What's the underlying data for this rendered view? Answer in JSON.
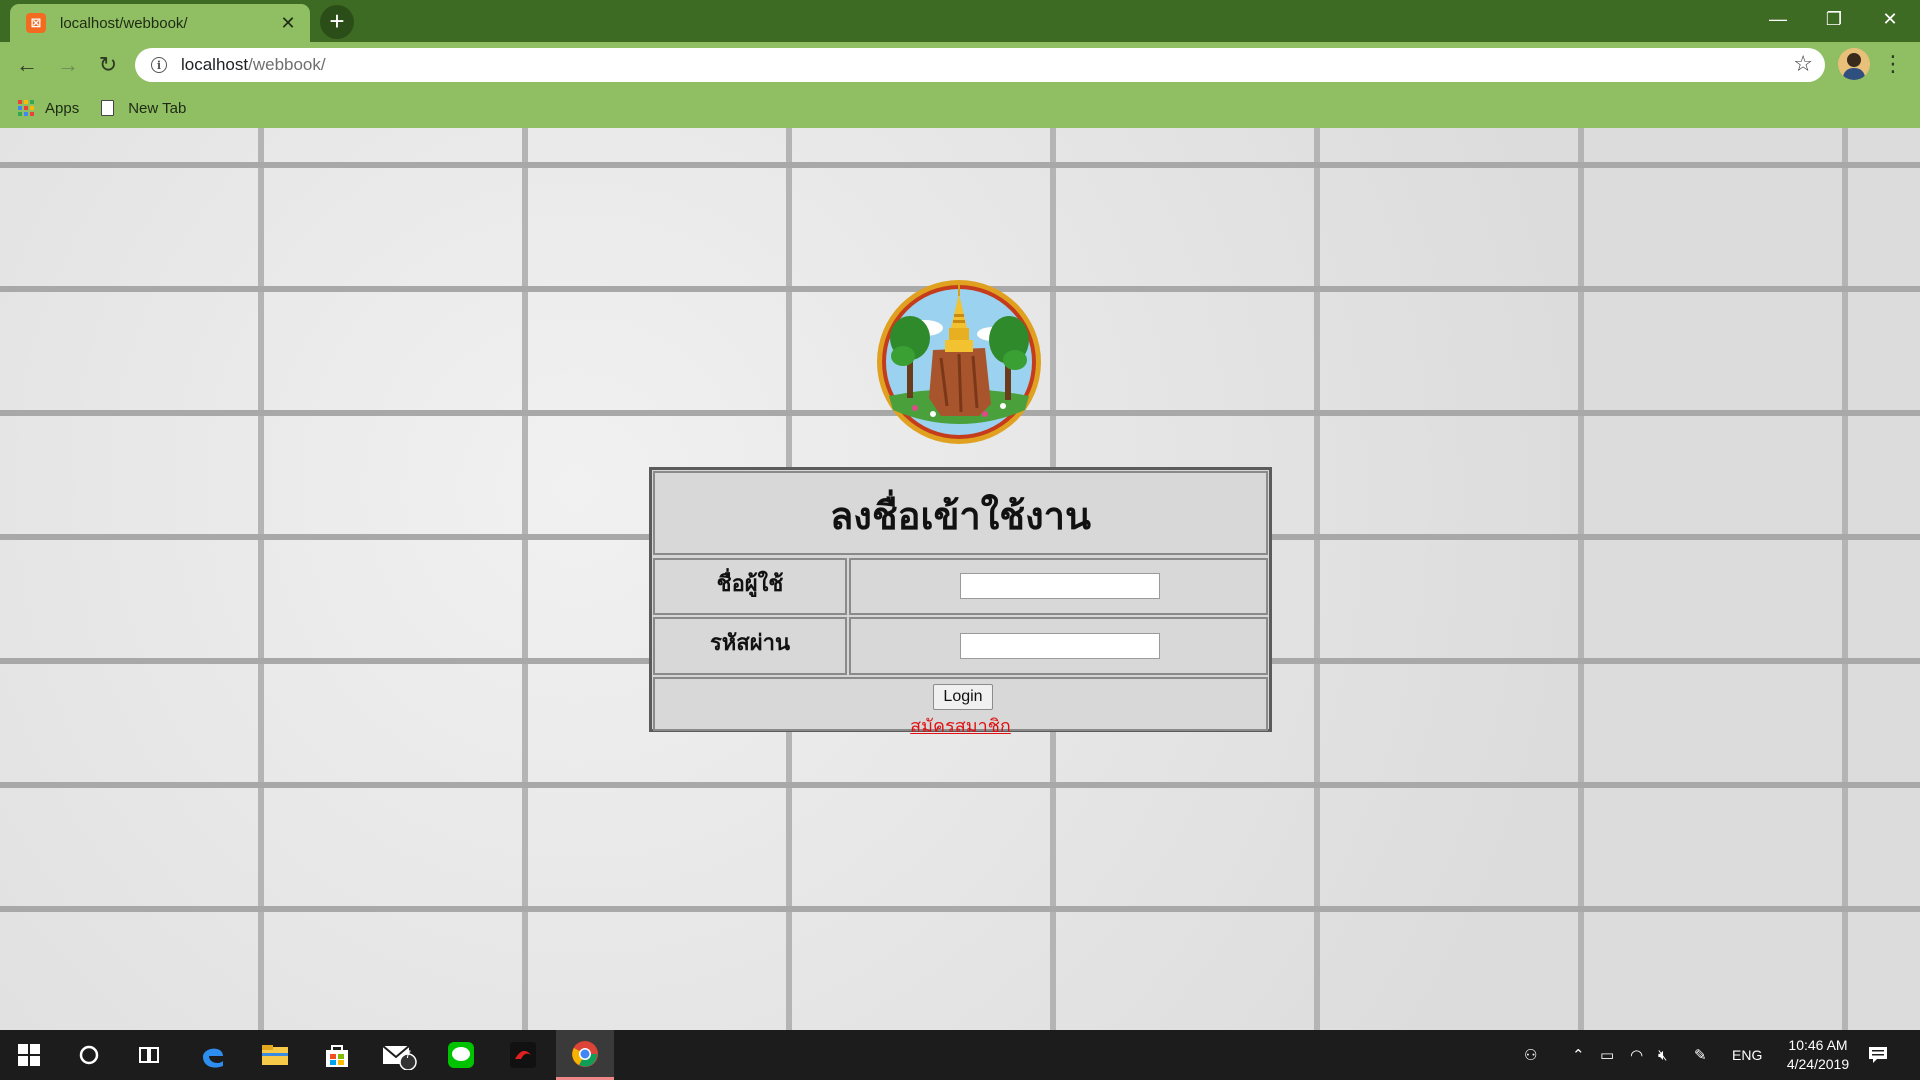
{
  "browser": {
    "tab_title": "localhost/webbook/",
    "address_host": "localhost",
    "address_path": "/webbook/",
    "bookmarks": [
      {
        "label": "Apps",
        "icon": "apps-grid-icon"
      },
      {
        "label": "New Tab",
        "icon": "page-icon"
      }
    ]
  },
  "login": {
    "title": "ลงชื่อเข้าใช้งาน",
    "username_label": "ชื่อผู้ใช้",
    "password_label": "รหัสผ่าน",
    "username_value": "",
    "password_value": "",
    "login_button": "Login",
    "register_link": "สมัครสมาชิก"
  },
  "taskbar": {
    "mail_badge": "7",
    "language": "ENG",
    "time": "10:46 AM",
    "date": "4/24/2019"
  },
  "colors": {
    "titlebar": "#3e6b24",
    "toolbar": "#8fbf62",
    "link": "#e01010",
    "table_bg": "#d8d8d8"
  }
}
